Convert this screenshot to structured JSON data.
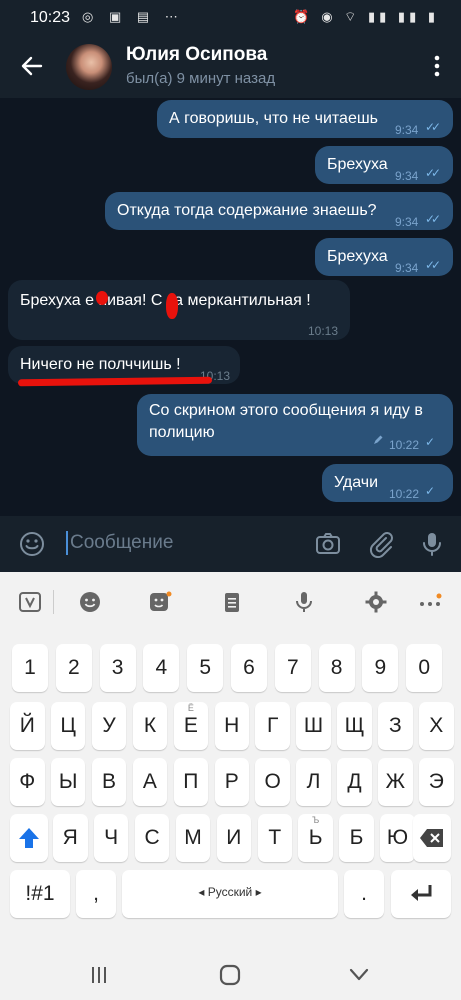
{
  "status_bar": {
    "time": "10:23"
  },
  "header": {
    "name": "Юлия Осипова",
    "status": "был(а) 9 минут назад"
  },
  "messages": [
    {
      "text": "А говоришь, что не читаешь",
      "time": "9:34",
      "direction": "out",
      "read": true
    },
    {
      "text": "Брехуха",
      "time": "9:34",
      "direction": "out",
      "read": true
    },
    {
      "text": "Откуда тогда содержание знаешь?",
      "time": "9:34",
      "direction": "out",
      "read": true
    },
    {
      "text": "Брехуха",
      "time": "9:34",
      "direction": "out",
      "read": true
    },
    {
      "text": "Брехуха е  пивая! С  ка меркантильная !",
      "time": "10:13",
      "direction": "in"
    },
    {
      "text": "Ничего не полччишь !",
      "time": "10:13",
      "direction": "in"
    },
    {
      "text_line1": "Со скрином этого сообщения я иду в",
      "text_line2": "полицию",
      "time": "10:22",
      "direction": "out",
      "edited": true,
      "read": false
    },
    {
      "text": "Удачи",
      "time": "10:22",
      "direction": "out",
      "read": false
    }
  ],
  "input": {
    "placeholder": "Сообщение"
  },
  "keyboard": {
    "row_numbers": [
      "1",
      "2",
      "3",
      "4",
      "5",
      "6",
      "7",
      "8",
      "9",
      "0"
    ],
    "row1": [
      "Й",
      "Ц",
      "У",
      "К",
      "Е",
      "Н",
      "Г",
      "Ш",
      "Щ",
      "З",
      "Х"
    ],
    "row1_sup": {
      "Е": "Ё"
    },
    "row2": [
      "Ф",
      "Ы",
      "В",
      "А",
      "П",
      "Р",
      "О",
      "Л",
      "Д",
      "Ж",
      "Э"
    ],
    "row3": [
      "Я",
      "Ч",
      "С",
      "М",
      "И",
      "Т",
      "Ь",
      "Б",
      "Ю"
    ],
    "row3_sup": {
      "Ь": "Ъ"
    },
    "symbols_key": "!#1",
    "comma": ",",
    "space_label": "◂ Русский ▸",
    "period": "."
  },
  "colors": {
    "accent": "#2b5278",
    "background": "#0e1621",
    "header": "#17212b",
    "incoming": "#182533",
    "highlight": "#e8120c"
  }
}
